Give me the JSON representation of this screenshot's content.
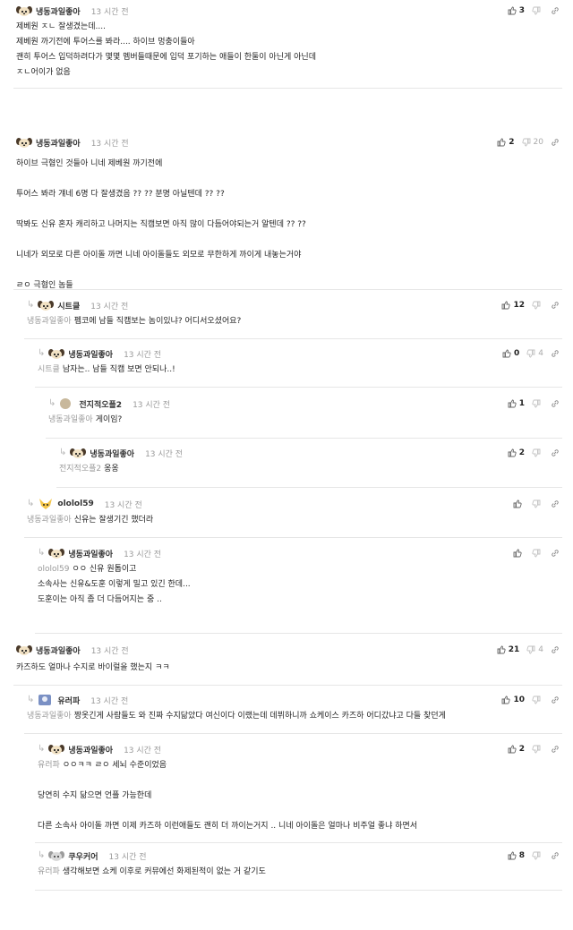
{
  "comments": [
    {
      "author": "냉동과일좋아",
      "time": "13 시간 전",
      "avatar": "dog-avatar-icon",
      "reply": false,
      "up": "3",
      "down": "",
      "lines": [
        {
          "text": "제베원 ㅈㄴ 잘생겼는데...."
        },
        {
          "text": "제베원 까기전에 투어스를 봐라.... 하이브 멍충이들아"
        },
        {
          "text": "괜히 투어스 입덕하려다가 몇몇 멤버들때문에 입덕 포기하는 애들이 한둘이 아닌게 아닌데"
        },
        {
          "text": "ㅈㄴ어이가 없음"
        },
        {
          "text": ""
        },
        {
          "text": "  ㅈㄴ어이가 없음"
        }
      ]
    },
    {
      "author": "냉동과일좋아",
      "time": "13 시간 전",
      "avatar": "dog-avatar-icon",
      "reply": false,
      "up": "2",
      "down": "20",
      "lines": [
        {
          "text": "하이브 극혐인 것들아 니네 제베원 까기전에"
        },
        {
          "text": ""
        },
        {
          "text": "투어스 봐라 걔네 6명 다 잘생겼음 ?? ?? 분명 아닐텐데 ?? ??"
        },
        {
          "text": ""
        },
        {
          "text": "딱봐도 신유 혼자 캐리하고 나머지는 직캠보면 아직 많이 다듬어야되는거 알텐데 ?? ??"
        },
        {
          "text": ""
        },
        {
          "text": "니네가 외모로 다른 아이돌 까면 니네 아이돌들도 외모로 무한하게 까이게 내놓는거야"
        },
        {
          "text": ""
        },
        {
          "text": "ㄹㅇ 극혐인 놈들"
        }
      ]
    },
    {
      "author": "시트클",
      "time": "13 시간 전",
      "avatar": "dog-avatar-icon",
      "reply": true,
      "up": "12",
      "down": "",
      "lines": [
        {
          "mention": "냉동과일좋아",
          "text": "펨코에 남들 직캠보는 놈이있냐? 어디서오셨어요?"
        }
      ]
    },
    {
      "author": "냉동과일좋아",
      "time": "13 시간 전",
      "avatar": "dog-avatar-icon",
      "reply": true,
      "up": "0",
      "down": "4",
      "lines": [
        {
          "mention": "시트클",
          "text": "남자는.. 남들 직캠 보면 안되나..!"
        }
      ]
    },
    {
      "author": "전지적오플2",
      "time": "13 시간 전",
      "avatar": "circle-avatar-icon",
      "reply": true,
      "up": "1",
      "down": "",
      "lines": [
        {
          "mention": "냉동과일좋아",
          "text": "게이임?"
        }
      ]
    },
    {
      "author": "냉동과일좋아",
      "time": "13 시간 전",
      "avatar": "dog-avatar-icon",
      "reply": true,
      "up": "2",
      "down": "",
      "lines": [
        {
          "mention": "전지적오플2",
          "text": "옹옹"
        }
      ]
    },
    {
      "author": "ololol59",
      "time": "13 시간 전",
      "avatar": "fox-avatar-icon",
      "reply": true,
      "up": "",
      "down": "",
      "lines": [
        {
          "mention": "냉동과일좋아",
          "text": "신유는 잘생기긴 했더라"
        }
      ]
    },
    {
      "author": "냉동과일좋아",
      "time": "13 시간 전",
      "avatar": "dog-avatar-icon",
      "reply": true,
      "up": "",
      "down": "",
      "lines": [
        {
          "mention": "ololol59",
          "text": "ㅇㅇ 신유 원톱이고"
        },
        {
          "text": "소속사는 신유&도훈 이렇게 밀고 있긴 한데..."
        },
        {
          "text": "도훈이는 아직 좀 더 다듬어지는 중 .."
        }
      ]
    },
    {
      "author": "냉동과일좋아",
      "time": "13 시간 전",
      "avatar": "dog-avatar-icon",
      "reply": false,
      "up": "21",
      "down": "4",
      "lines": [
        {
          "text": "카즈하도 얼마나 수지로 바이럴을 했는지 ㅋㅋ"
        }
      ]
    },
    {
      "author": "유러파",
      "time": "13 시간 전",
      "avatar": "grey-avatar-icon",
      "reply": true,
      "up": "10",
      "down": "",
      "lines": [
        {
          "mention": "냉동과일좋아",
          "text": "짱옷긴게 사람들도 와 진짜 수지닮았다 여신이다 이랬는데 데뷔하니까 쇼케이스 카즈하 어디갔냐고 다들 찾던게"
        }
      ]
    },
    {
      "author": "냉동과일좋아",
      "time": "13 시간 전",
      "avatar": "dog-avatar-icon",
      "reply": true,
      "up": "2",
      "down": "",
      "lines": [
        {
          "mention": "유러파",
          "text": "ㅇㅇㅋㅋ ㄹㅇ 세뇌 수준이었음"
        },
        {
          "text": ""
        },
        {
          "text": "당연히 수지 닮으면 언플 가능한데"
        },
        {
          "text": ""
        },
        {
          "text": "다른 소속사 아이돌 까면 이제 카즈하 이런애들도 괜히 더 까이는거지 .. 니네 아이돌은 얼마나 비주얼 좋냐 하면서"
        }
      ]
    },
    {
      "author": "쿠우커어",
      "time": "13 시간 전",
      "avatar": "grey-dog-avatar-icon",
      "reply": true,
      "up": "8",
      "down": "",
      "lines": [
        {
          "mention": "유러파",
          "text": "생각해보면 쇼케 이후로 커뮤에선 화제된적이 없는 거 같기도"
        }
      ]
    }
  ]
}
